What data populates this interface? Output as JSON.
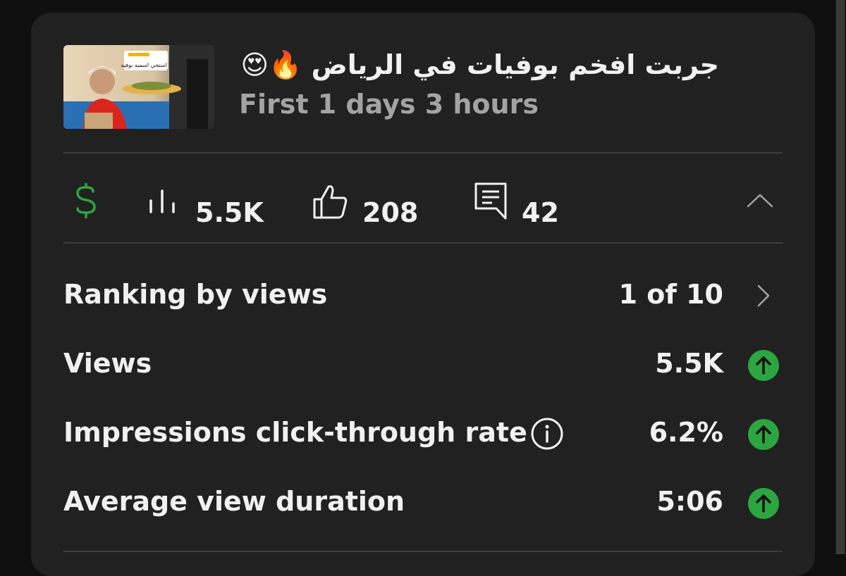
{
  "video": {
    "title": "جربت افخم بوفيات في الرياض 🔥😍",
    "period": "First 1 days 3 hours",
    "thumbnail_text": "استحي اسميه بوفيه !"
  },
  "stats": {
    "views": "5.5K",
    "likes": "208",
    "comments": "42"
  },
  "metrics": [
    {
      "label": "Ranking by views",
      "value": "1 of 10",
      "action": "chevron-right-icon"
    },
    {
      "label": "Views",
      "value": "5.5K",
      "trend": "up"
    },
    {
      "label": "Impressions click-through rate",
      "value": "6.2%",
      "trend": "up",
      "info": true
    },
    {
      "label": "Average view duration",
      "value": "5:06",
      "trend": "up"
    }
  ],
  "colors": {
    "background": "#0f0f0f",
    "card": "#212121",
    "divider": "#3d3d3d",
    "monetization_green": "#2ba640",
    "trend_up_green": "#2ba640",
    "secondary_text": "#a3a3a3"
  }
}
